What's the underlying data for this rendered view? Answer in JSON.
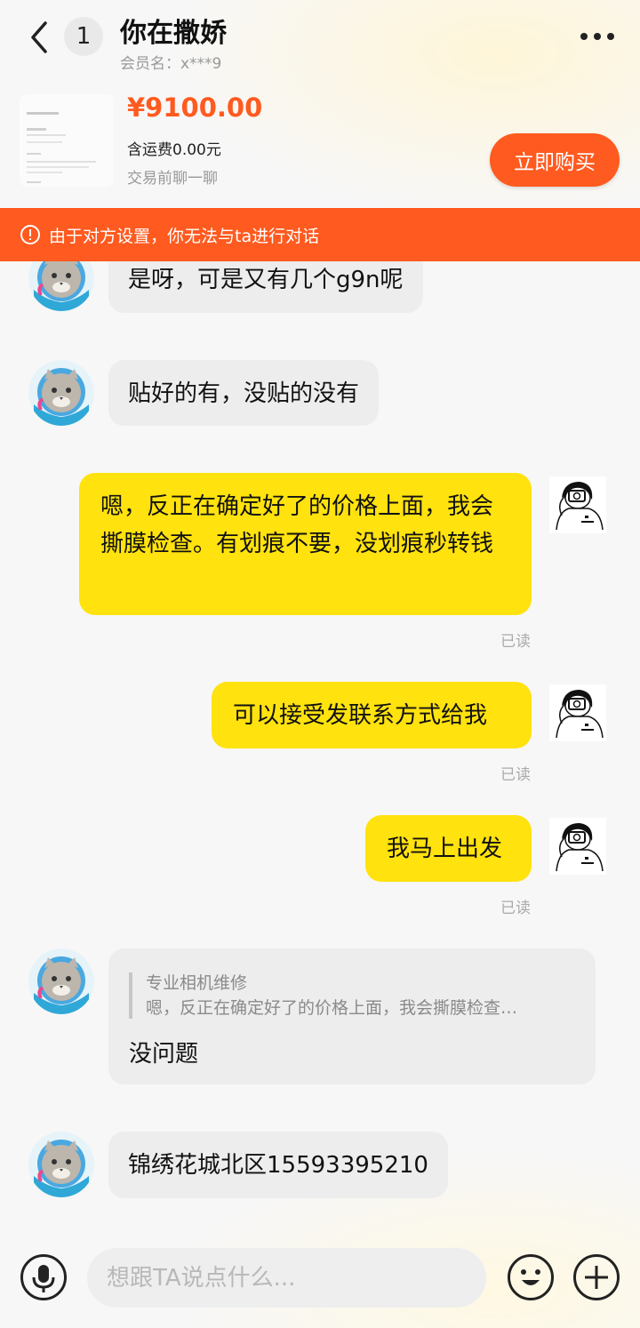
{
  "header": {
    "unread_count": "1",
    "title": "你在撒娇",
    "member_label": "会员名：x***9"
  },
  "product": {
    "price": "¥9100.00",
    "shipping": "含运费0.00元",
    "tip": "交易前聊一聊",
    "buy_label": "立即购买"
  },
  "warning": {
    "text": "由于对方设置，你无法与ta进行对话"
  },
  "messages": [
    {
      "side": "left",
      "text": "是呀，可是又有几个g9n呢"
    },
    {
      "side": "left",
      "text": "贴好的有，没贴的没有"
    },
    {
      "side": "right",
      "text": "嗯，反正在确定好了的价格上面，我会撕膜检查。有划痕不要，没划痕秒转钱",
      "status": "已读"
    },
    {
      "side": "right",
      "text": "可以接受发联系方式给我",
      "status": "已读"
    },
    {
      "side": "right",
      "text": "我马上出发",
      "status": "已读"
    },
    {
      "side": "left",
      "quote_name": "专业相机维修",
      "quote_text": "嗯，反正在确定好了的价格上面，我会撕膜检查…",
      "text": "没问题"
    },
    {
      "side": "left",
      "text": "锦绣花城北区15593395210"
    }
  ],
  "input": {
    "placeholder": "想跟TA说点什么..."
  },
  "colors": {
    "accent": "#ff5a1f",
    "my_bubble": "#ffe20e",
    "their_bubble": "#ededed"
  },
  "icons": [
    "back-arrow-icon",
    "more-dots-icon",
    "warning-circle-icon",
    "microphone-icon",
    "emoji-face-icon",
    "plus-circle-icon"
  ]
}
